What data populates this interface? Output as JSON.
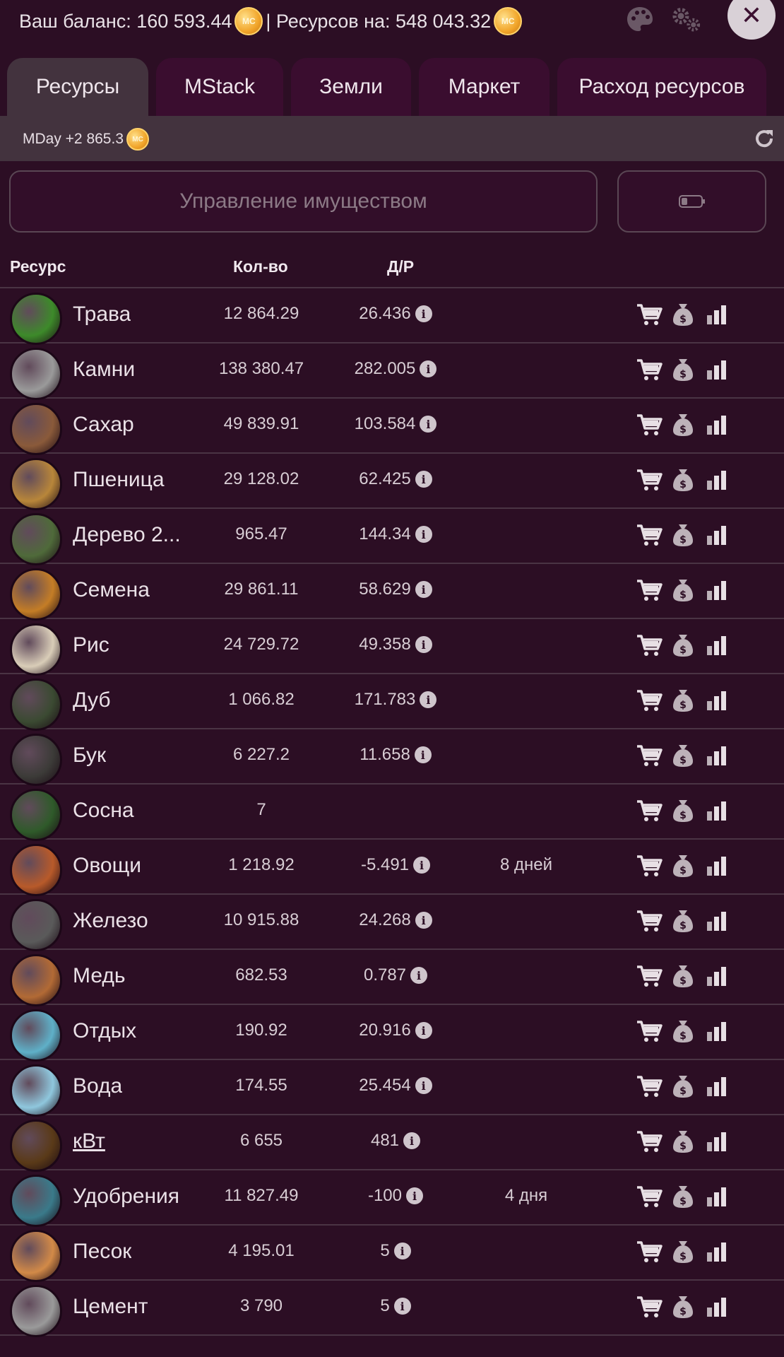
{
  "header": {
    "balance_label": "Ваш баланс: 160 593.44",
    "separator": "| Ресурсов на: 548 043.32",
    "coin_text": "MC"
  },
  "tabs": [
    {
      "label": "Ресурсы",
      "active": true
    },
    {
      "label": "MStack"
    },
    {
      "label": "Земли"
    },
    {
      "label": "Маркет"
    },
    {
      "label": "Расход ресурсов"
    }
  ],
  "subbar": {
    "mday": "MDay +2 865.3"
  },
  "manage_button": "Управление имуществом",
  "table": {
    "headers": {
      "resource": "Ресурс",
      "qty": "Кол-во",
      "dr": "Д/Р"
    },
    "rows": [
      {
        "name": "Трава",
        "qty": "12 864.29",
        "dr": "26.436",
        "days": "",
        "color": "#3d8a2a"
      },
      {
        "name": "Камни",
        "qty": "138 380.47",
        "dr": "282.005",
        "days": "",
        "color": "#9a9a9a"
      },
      {
        "name": "Сахар",
        "qty": "49 839.91",
        "dr": "103.584",
        "days": "",
        "color": "#8a5a3a"
      },
      {
        "name": "Пшеница",
        "qty": "29 128.02",
        "dr": "62.425",
        "days": "",
        "color": "#b8863a"
      },
      {
        "name": "Дерево 2...",
        "qty": "965.47",
        "dr": "144.34",
        "days": "",
        "color": "#4f6a3a"
      },
      {
        "name": "Семена",
        "qty": "29 861.11",
        "dr": "58.629",
        "days": "",
        "color": "#c47d26"
      },
      {
        "name": "Рис",
        "qty": "24 729.72",
        "dr": "49.358",
        "days": "",
        "color": "#d9cdb8"
      },
      {
        "name": "Дуб",
        "qty": "1 066.82",
        "dr": "171.783",
        "days": "",
        "color": "#3b4a32"
      },
      {
        "name": "Бук",
        "qty": "6 227.2",
        "dr": "11.658",
        "days": "",
        "color": "#3c3b38"
      },
      {
        "name": "Сосна",
        "qty": "7",
        "dr": "",
        "days": "",
        "color": "#2f5a2a"
      },
      {
        "name": "Овощи",
        "qty": "1 218.92",
        "dr": "-5.491",
        "days": "8 дней",
        "color": "#b85a2a"
      },
      {
        "name": "Железо",
        "qty": "10 915.88",
        "dr": "24.268",
        "days": "",
        "color": "#5a5a5a"
      },
      {
        "name": "Медь",
        "qty": "682.53",
        "dr": "0.787",
        "days": "",
        "color": "#b26a35"
      },
      {
        "name": "Отдых",
        "qty": "190.92",
        "dr": "20.916",
        "days": "",
        "color": "#5fb0c8"
      },
      {
        "name": "Вода",
        "qty": "174.55",
        "dr": "25.454",
        "days": "",
        "color": "#8fc7dd"
      },
      {
        "name": "кВт",
        "qty": "6 655",
        "dr": "481",
        "days": "",
        "color": "#5a3a18",
        "link": true
      },
      {
        "name": "Удобрения",
        "qty": "11 827.49",
        "dr": "-100",
        "days": "4 дня",
        "color": "#3a7a8a"
      },
      {
        "name": "Песок",
        "qty": "4 195.01",
        "dr": "5",
        "days": "",
        "color": "#d28a48"
      },
      {
        "name": "Цемент",
        "qty": "3 790",
        "dr": "5",
        "days": "",
        "color": "#9a9a9a"
      }
    ]
  },
  "icons": {
    "palette": "palette-icon",
    "settings": "gears-icon",
    "close": "close-icon",
    "refresh": "refresh-icon",
    "battery": "battery-icon",
    "cart": "cart-icon",
    "money": "money-bag-icon",
    "chart": "bar-chart-icon"
  }
}
